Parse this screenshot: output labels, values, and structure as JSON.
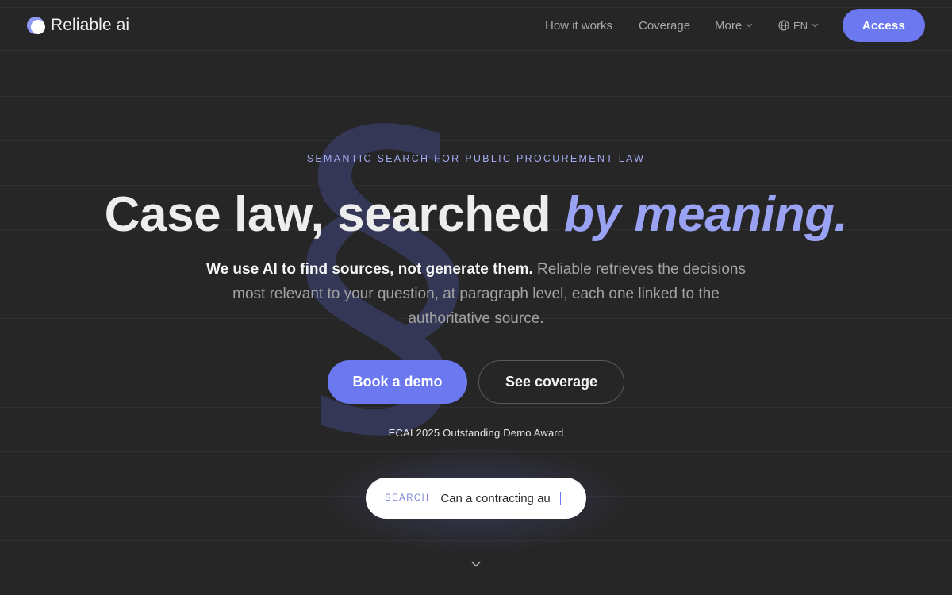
{
  "header": {
    "brand": "Reliable ai",
    "nav": {
      "how_it_works": "How it works",
      "coverage": "Coverage",
      "more": "More",
      "language": "EN"
    },
    "access_label": "Access"
  },
  "hero": {
    "eyebrow": "SEMANTIC SEARCH FOR PUBLIC PROCUREMENT LAW",
    "headline_main": "Case law, searched ",
    "headline_accent": "by meaning.",
    "lede_strong": "We use AI to find sources, not generate them.",
    "lede_rest": " Reliable retrieves the decisions most relevant to your question, at paragraph level, each one linked to the authoritative source.",
    "cta_primary": "Book a demo",
    "cta_secondary": "See coverage",
    "award": "ECAI 2025 Outstanding Demo Award",
    "decor_symbol": "§"
  },
  "search": {
    "label": "SEARCH",
    "value": "Can a contracting au"
  },
  "colors": {
    "background": "#262626",
    "accent": "#6b78f0",
    "accent_text": "#9aa2f3"
  },
  "icons": {
    "logo": "crescent-moon-logo-icon",
    "language": "globe-icon",
    "dropdown": "chevron-down-icon",
    "scroll": "chevron-down-icon"
  }
}
